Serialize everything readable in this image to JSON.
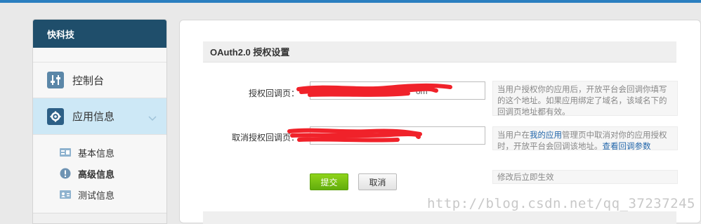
{
  "sidebar": {
    "title": "快科技",
    "nav": [
      {
        "label": "控制台",
        "icon": "sliders-icon"
      },
      {
        "label": "应用信息",
        "icon": "gear-icon",
        "active": true
      }
    ],
    "sub_items": [
      {
        "label": "基本信息",
        "icon": "id-card-icon",
        "bold": false
      },
      {
        "label": "高级信息",
        "icon": "exclamation-icon",
        "bold": true
      },
      {
        "label": "测试信息",
        "icon": "person-card-icon",
        "bold": false
      }
    ]
  },
  "main": {
    "section_title": "OAuth2.0 授权设置",
    "fields": [
      {
        "label": "授权回调页：",
        "value": "",
        "hint": "当用户授权你的应用后，开放平台会回调你填写的这个地址。如果应用绑定了域名，该域名下的回调页地址都有效。"
      },
      {
        "label": "取消授权回调页：",
        "value": "",
        "hint_prefix": "当用户在",
        "hint_link1": "我的应用",
        "hint_mid": "管理页中取消对你的应用授权时，开放平台会回调该地址。",
        "hint_link2": "查看回调参数"
      }
    ],
    "submit_label": "提交",
    "cancel_label": "取消",
    "note": "修改后立即生效",
    "partial_text": "om"
  },
  "watermark": "http://blog.csdn.net/qq_37237245",
  "colors": {
    "topbar": "#2b7fc0",
    "sidebar_header": "#1f4e6b",
    "active_nav": "#cde8f6",
    "submit_green": "#62ad0d",
    "redaction": "#f0222a"
  }
}
